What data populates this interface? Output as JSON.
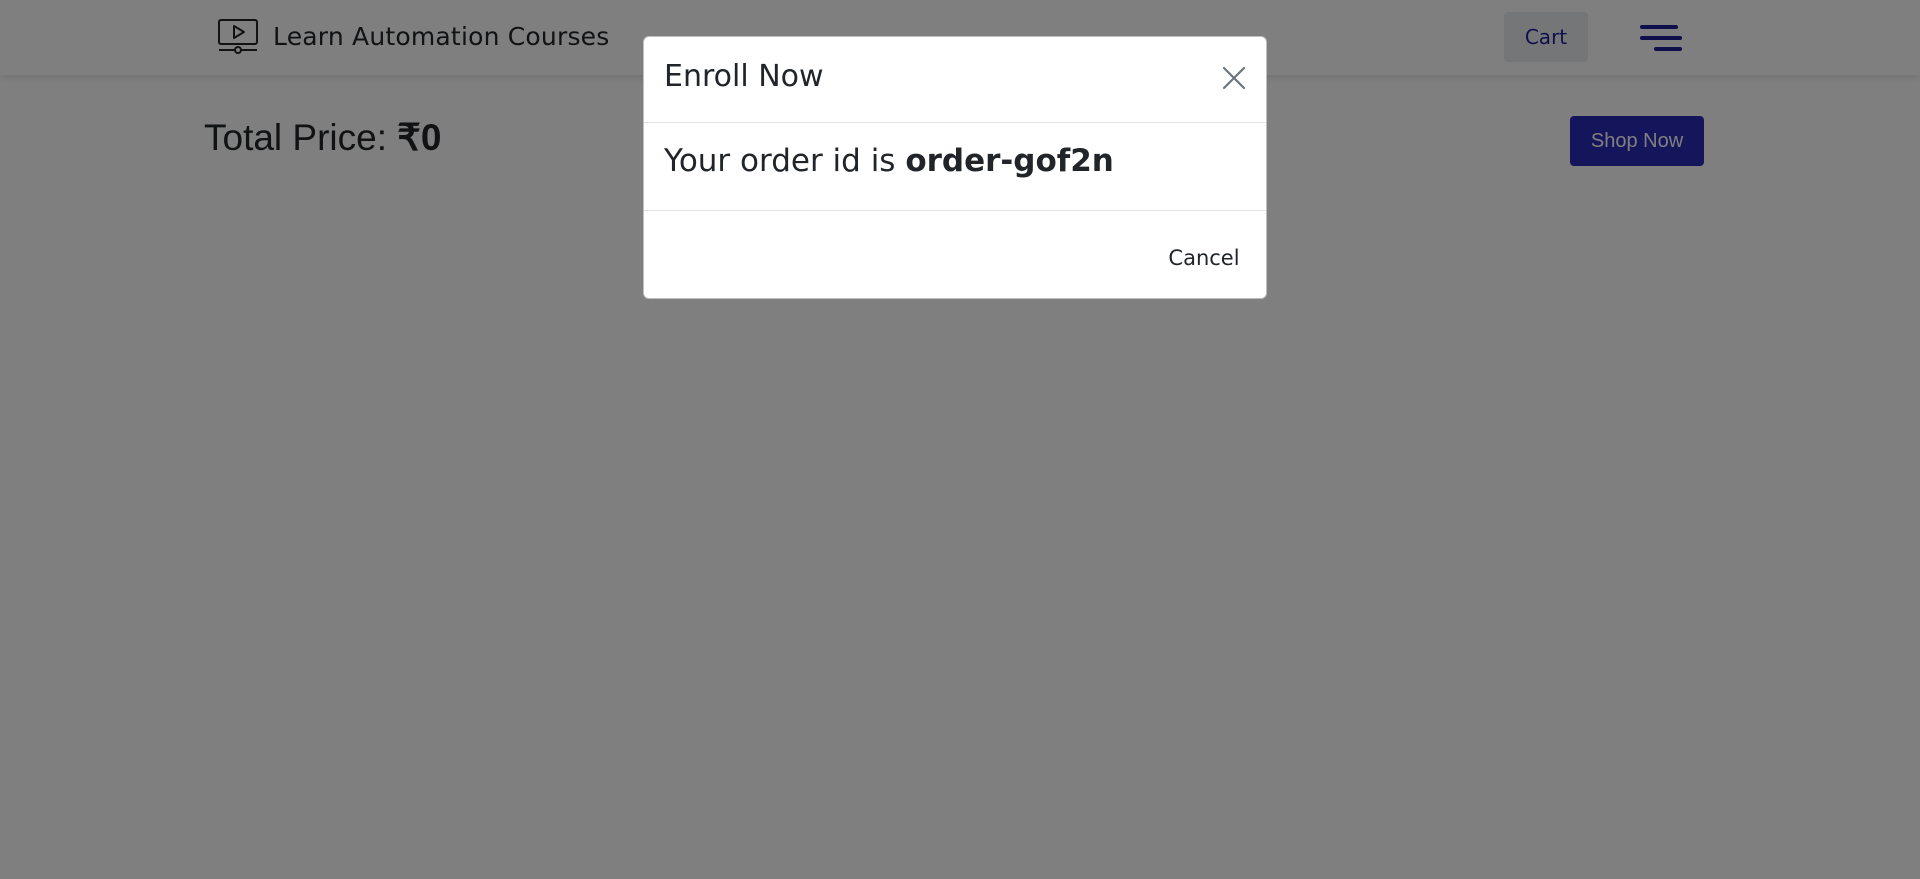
{
  "header": {
    "brand_icon": "video-play-icon",
    "title": "Learn Automation Courses",
    "cart_label": "Cart",
    "menu_icon": "hamburger-menu-icon"
  },
  "main": {
    "total_label": "Total Price: ",
    "total_amount": "₹0",
    "shop_now_label": "Shop Now"
  },
  "modal": {
    "title": "Enroll Now",
    "close_icon": "close-icon",
    "message_prefix": "Your order id is ",
    "order_id": "order-gof2n",
    "cancel_label": "Cancel"
  },
  "colors": {
    "accent": "#1e1e96",
    "button_primary": "#2a2ab8",
    "overlay": "rgba(0,0,0,0.5)"
  }
}
